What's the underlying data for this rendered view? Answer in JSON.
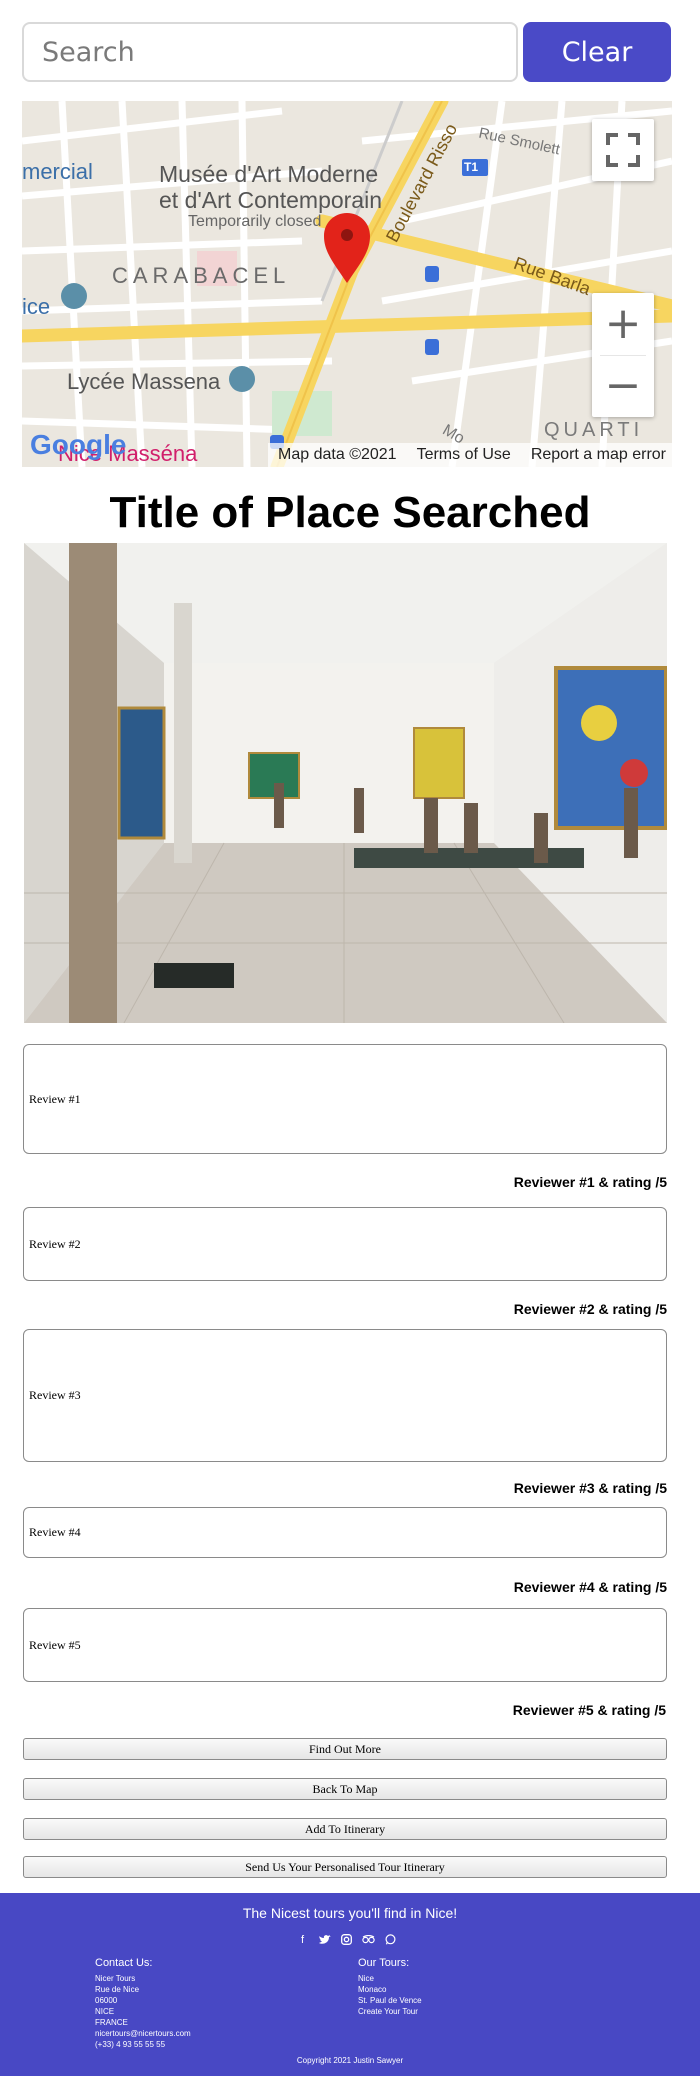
{
  "search": {
    "placeholder": "Search",
    "clear_label": "Clear"
  },
  "map": {
    "labels": {
      "museum_line1": "Musée d'Art Moderne",
      "museum_line2": "et d'Art Contemporain",
      "temporarily_closed": "Temporarily closed",
      "carabacel": "CARABACEL",
      "lycee": "Lycée Massena",
      "boulevard": "Boulevard Risso",
      "rue_smolett": "Rue Smolett",
      "rue_barla": "Rue Barla",
      "quartier": "QUARTI",
      "commercial": "mercial",
      "nice_partial": "ice",
      "nice_massena": "Nice Masséna",
      "t1": "T1",
      "mo": "Mo"
    },
    "google_logo": "Google",
    "attribution": {
      "data": "Map data ©2021",
      "terms": "Terms of Use",
      "report": "Report a map error"
    }
  },
  "place": {
    "title": "Title of Place Searched"
  },
  "reviews": [
    {
      "text": "Review #1",
      "reviewer": "Reviewer #1 & rating /5"
    },
    {
      "text": "Review #2",
      "reviewer": "Reviewer #2 & rating /5"
    },
    {
      "text": "Review #3",
      "reviewer": "Reviewer #3 & rating /5"
    },
    {
      "text": "Review #4",
      "reviewer": "Reviewer #4 & rating /5"
    },
    {
      "text": "Review #5",
      "reviewer": "Reviewer #5 & rating /5"
    }
  ],
  "actions": {
    "find_out_more": "Find Out More",
    "back_to_map": "Back To Map",
    "add_to_itinerary": "Add To Itinerary",
    "send_itinerary": "Send Us Your Personalised Tour Itinerary"
  },
  "footer": {
    "tagline": "The Nicest tours you'll find in Nice!",
    "social_icons": [
      "facebook-icon",
      "twitter-icon",
      "instagram-icon",
      "tripadvisor-icon",
      "whatsapp-icon"
    ],
    "contact": {
      "heading": "Contact Us:",
      "lines": [
        "Nicer Tours",
        "Rue de Nice",
        "06000",
        "NICE",
        "FRANCE",
        "nicertours@nicertours.com",
        "(+33) 4 93 55 55 55"
      ]
    },
    "tours": {
      "heading": "Our Tours:",
      "links": [
        "Nice",
        "Monaco",
        "St. Paul de Vence",
        "Create Your Tour"
      ]
    },
    "copyright": "Copyright 2021 Justin Sawyer"
  },
  "colors": {
    "accent": "#4a4ac7",
    "footer_bg": "#4848c4",
    "map_pin": "#e2231a"
  }
}
